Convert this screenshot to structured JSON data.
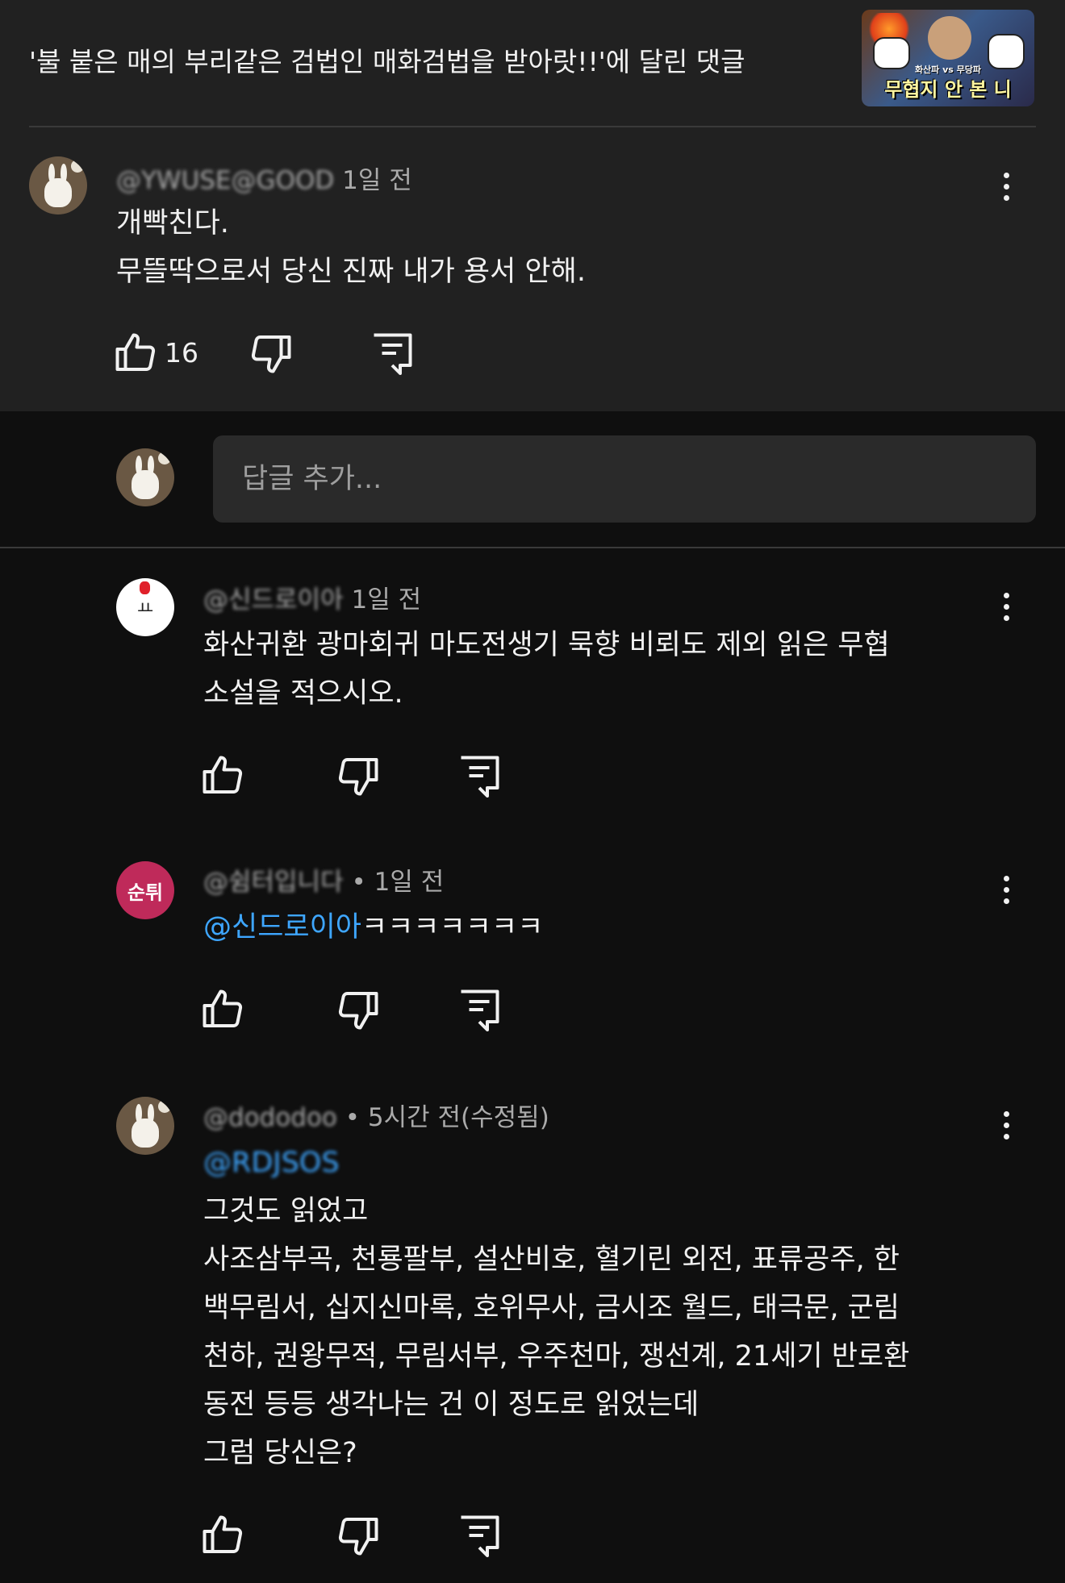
{
  "header": {
    "title": "'불 붙은 매의 부리같은 검법인 매화검법을 받아랏!!'에 달린 댓글",
    "thumbnail_text": "무협지 안 본 니",
    "thumbnail_subtext": "화산파 vs 무당파"
  },
  "main_comment": {
    "handle": "@YWUSE@GOOD",
    "time": "1일 전",
    "lines": [
      "개빡친다.",
      "무뜰딱으로서 당신 진짜 내가 용서 안해."
    ],
    "like_count": "16"
  },
  "reply_box": {
    "placeholder": "답글 추가..."
  },
  "replies": [
    {
      "handle": "@신드로이아",
      "time": "1일 전",
      "lines": [
        "화산귀환 광마회귀 마도전생기 묵향 비뢰도 제외 읽은 무협",
        "소설을 적으시오."
      ],
      "avatar_type": "white"
    },
    {
      "handle": "@쉼터입니다",
      "time": "• 1일 전",
      "mention": "@신드로이아",
      "text_after_mention": "ㅋㅋㅋㅋㅋㅋㅋ",
      "avatar_label": "순튀",
      "avatar_type": "pink"
    },
    {
      "handle": "@dododoo",
      "time": "• 5시간 전(수정됨)",
      "mention": "@RDJSOS",
      "lines": [
        "그것도 읽었고",
        "사조삼부곡, 천룡팔부, 설산비호, 혈기린 외전, 표류공주, 한",
        "백무림서, 십지신마록, 호위무사, 금시조 월드, 태극문, 군림",
        "천하, 권왕무적, 무림서부, 우주천마, 쟁선계, 21세기 반로환",
        "동전 등등 생각나는 건 이 정도로 읽었는데",
        "그럼 당신은?"
      ],
      "avatar_type": "bunny"
    }
  ],
  "colors": {
    "background": "#0f0f0f",
    "panel": "#212121",
    "input": "#2a2a2a",
    "mention": "#3ea6ff",
    "avatar_pink": "#bf2a5a"
  },
  "icons": [
    "like-icon",
    "dislike-icon",
    "reply-icon",
    "more-vert-icon"
  ]
}
